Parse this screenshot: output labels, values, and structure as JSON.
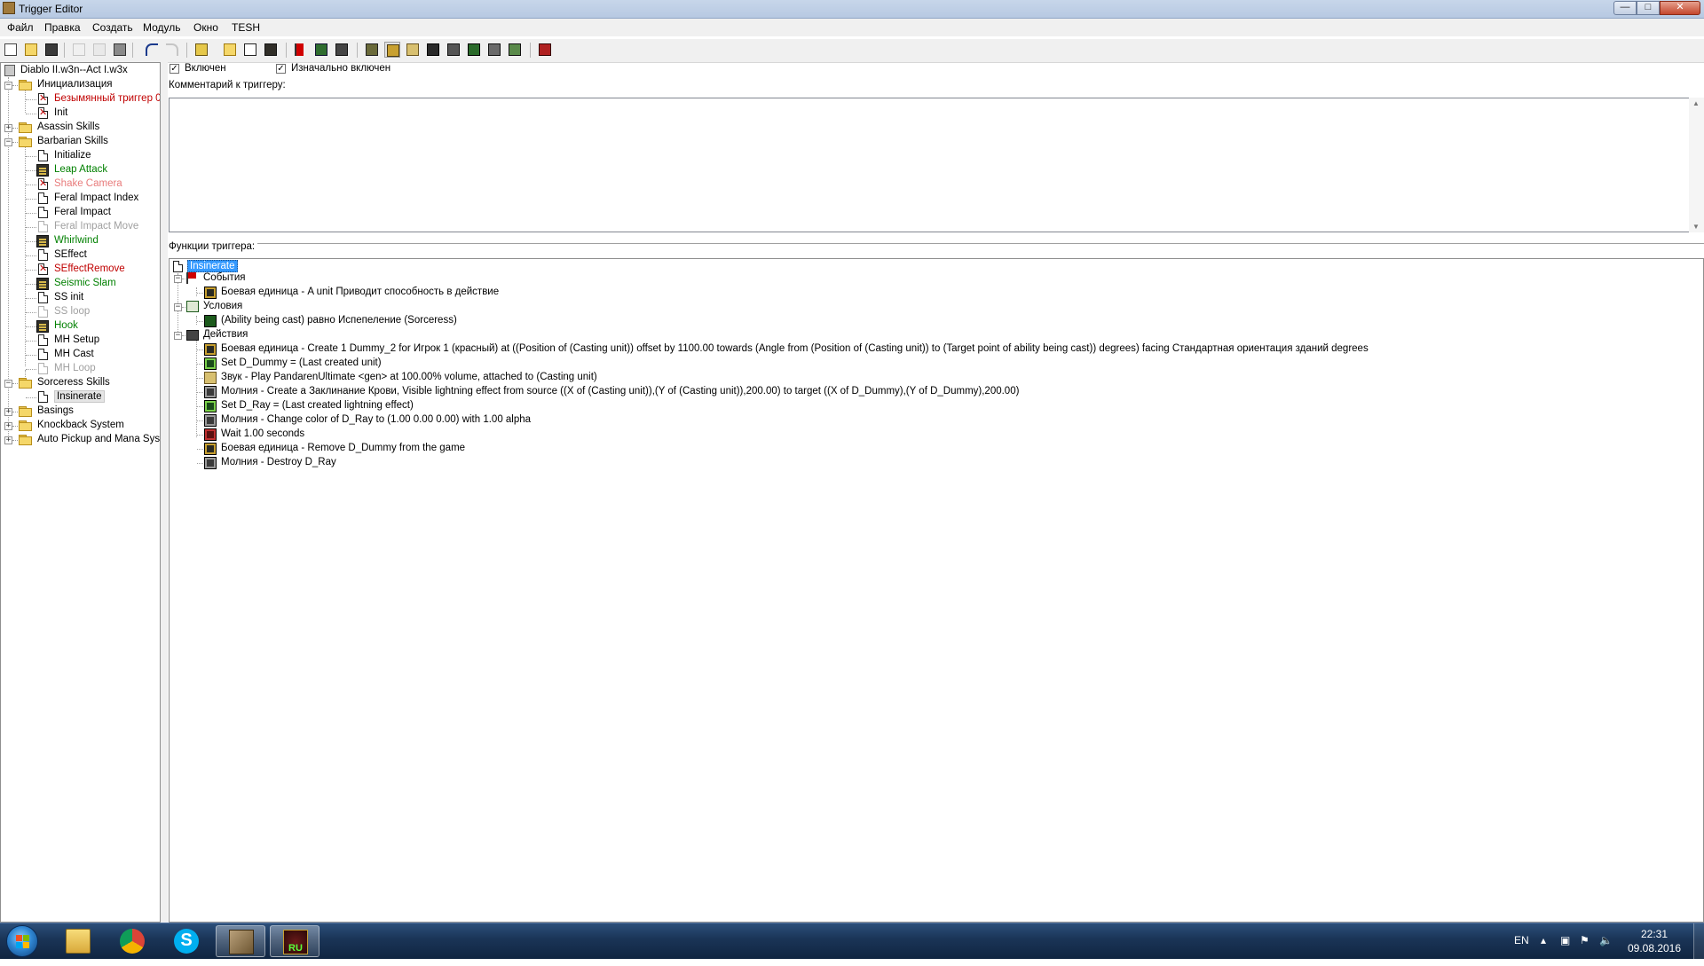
{
  "window": {
    "title": "Trigger Editor",
    "min": "—",
    "max": "□",
    "close": "✕"
  },
  "menu": [
    "Файл",
    "Правка",
    "Создать",
    "Модуль",
    "Окно",
    "TESH"
  ],
  "tree": {
    "root": "Diablo II.w3n--Act I.w3x",
    "items": [
      {
        "label": "Инициализация",
        "type": "folder",
        "level": 1,
        "state": "expanded",
        "color": "#000000"
      },
      {
        "label": "Безымянный триггер 0",
        "type": "trigger",
        "level": 2,
        "icon": "error",
        "color": "#c00000"
      },
      {
        "label": "Init",
        "type": "trigger",
        "level": 2,
        "icon": "error",
        "color": "#000000"
      },
      {
        "label": "Asassin Skills",
        "type": "folder",
        "level": 1,
        "state": "collapsed",
        "color": "#000000"
      },
      {
        "label": "Barbarian Skills",
        "type": "folder",
        "level": 1,
        "state": "expanded",
        "color": "#000000"
      },
      {
        "label": "Initialize",
        "type": "trigger",
        "level": 2,
        "icon": "doc",
        "color": "#000000"
      },
      {
        "label": "Leap Attack",
        "type": "trigger",
        "level": 2,
        "icon": "gui",
        "color": "#008000"
      },
      {
        "label": "Shake Camera",
        "type": "trigger",
        "level": 2,
        "icon": "error",
        "color": "#e87c7c"
      },
      {
        "label": "Feral Impact Index",
        "type": "trigger",
        "level": 2,
        "icon": "doc",
        "color": "#000000"
      },
      {
        "label": "Feral Impact",
        "type": "trigger",
        "level": 2,
        "icon": "doc",
        "color": "#000000"
      },
      {
        "label": "Feral Impact Move",
        "type": "trigger",
        "level": 2,
        "icon": "doc-disabled",
        "color": "#a0a0a0"
      },
      {
        "label": "Whirlwind",
        "type": "trigger",
        "level": 2,
        "icon": "gui",
        "color": "#008000"
      },
      {
        "label": "SEffect",
        "type": "trigger",
        "level": 2,
        "icon": "doc",
        "color": "#000000"
      },
      {
        "label": "SEffectRemove",
        "type": "trigger",
        "level": 2,
        "icon": "error",
        "color": "#c00000"
      },
      {
        "label": "Seismic Slam",
        "type": "trigger",
        "level": 2,
        "icon": "gui",
        "color": "#008000"
      },
      {
        "label": "SS init",
        "type": "trigger",
        "level": 2,
        "icon": "doc",
        "color": "#000000"
      },
      {
        "label": "SS loop",
        "type": "trigger",
        "level": 2,
        "icon": "doc-disabled",
        "color": "#a0a0a0"
      },
      {
        "label": "Hook",
        "type": "trigger",
        "level": 2,
        "icon": "gui",
        "color": "#008000"
      },
      {
        "label": "MH Setup",
        "type": "trigger",
        "level": 2,
        "icon": "doc",
        "color": "#000000"
      },
      {
        "label": "MH Cast",
        "type": "trigger",
        "level": 2,
        "icon": "doc",
        "color": "#000000"
      },
      {
        "label": "MH Loop",
        "type": "trigger",
        "level": 2,
        "icon": "doc-disabled",
        "color": "#a0a0a0"
      },
      {
        "label": "Sorceress Skills",
        "type": "folder",
        "level": 1,
        "state": "expanded",
        "color": "#000000"
      },
      {
        "label": "Insinerate",
        "type": "trigger",
        "level": 2,
        "icon": "doc",
        "color": "#000000",
        "selected": true
      },
      {
        "label": "Basings",
        "type": "folder",
        "level": 1,
        "state": "collapsed",
        "color": "#000000"
      },
      {
        "label": "Knockback System",
        "type": "folder",
        "level": 1,
        "state": "collapsed",
        "color": "#000000"
      },
      {
        "label": "Auto Pickup and Mana System",
        "type": "folder",
        "level": 1,
        "state": "collapsed",
        "color": "#000000"
      }
    ],
    "scroll_grip": "|||"
  },
  "trigger": {
    "enabled_label": "Включен",
    "initially_enabled_label": "Изначально включен",
    "comment_label": "Комментарий к триггеру:",
    "comment_text": "",
    "functions_label": "Функции триггера:",
    "name": "Insinerate",
    "events_label": "События",
    "conditions_label": "Условия",
    "actions_label": "Действия",
    "events": [
      {
        "text": "Боевая единица - A unit Приводит способность в действие",
        "icon": "unit"
      }
    ],
    "conditions": [
      {
        "text": "(Ability being cast) равно Испепеление (Sorceress)",
        "icon": "condition"
      }
    ],
    "actions": [
      {
        "text": "Боевая единица - Create 1 Dummy_2 for Игрок 1 (красный) at ((Position of (Casting unit)) offset by 1100.00 towards (Angle from (Position of (Casting unit)) to (Target point of ability being cast)) degrees) facing Стандартная ориентация зданий degrees",
        "icon": "unit"
      },
      {
        "text": "Set D_Dummy = (Last created unit)",
        "icon": "set"
      },
      {
        "text": "Звук - Play PandarenUltimate <gen> at 100.00% volume, attached to (Casting unit)",
        "icon": "sound"
      },
      {
        "text": "Молния - Create a Заклинание Крови, Visible lightning effect from source ((X of (Casting unit)),(Y of (Casting unit)),200.00) to target ((X of D_Dummy),(Y of D_Dummy),200.00)",
        "icon": "lightning"
      },
      {
        "text": "Set D_Ray = (Last created lightning effect)",
        "icon": "set"
      },
      {
        "text": "Молния - Change color of D_Ray to (1.00 0.00 0.00) with 1.00 alpha",
        "icon": "lightning"
      },
      {
        "text": "Wait 1.00 seconds",
        "icon": "wait"
      },
      {
        "text": "Боевая единица - Remove D_Dummy from the game",
        "icon": "unit"
      },
      {
        "text": "Молния - Destroy D_Ray",
        "icon": "lightning"
      }
    ]
  },
  "taskbar": {
    "language": "EN",
    "time": "22:31",
    "date": "09.08.2016"
  },
  "colors": {
    "selection": "#3399ff",
    "green_trigger": "#008000",
    "error_trigger": "#c00000",
    "disabled_trigger": "#a0a0a0"
  }
}
